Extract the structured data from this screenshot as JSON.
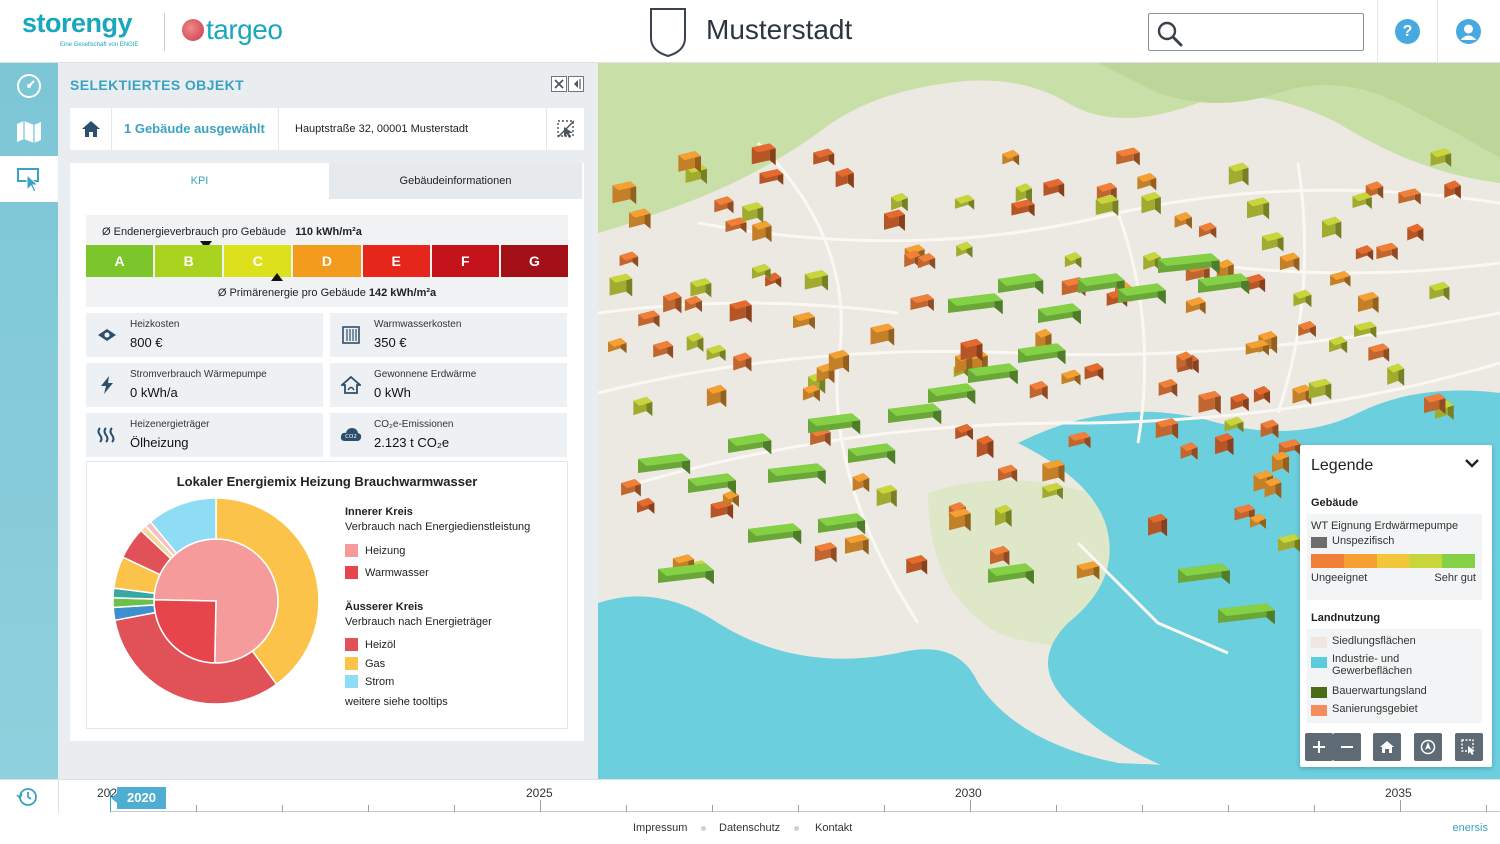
{
  "header": {
    "brand_primary": "storengy",
    "brand_primary_sub": "Eine Gesellschaft von ENGIE",
    "brand_secondary": "targeo",
    "city": "Musterstadt",
    "search": {
      "placeholder": "",
      "value": ""
    },
    "help_label": "?",
    "accent": "#1aa7bd"
  },
  "sidebar": {
    "items": [
      {
        "icon": "dashboard-gauge-icon",
        "active": false
      },
      {
        "icon": "map-icon",
        "active": false
      },
      {
        "icon": "select-object-icon",
        "active": true
      }
    ],
    "history_icon": "history-clock-icon"
  },
  "panel": {
    "title": "SELEKTIERTES OBJEKT",
    "selection": {
      "count_label": "1 Gebäude ausgewählt",
      "address": "Hauptstraße 32, 00001 Musterstadt"
    },
    "tabs": [
      {
        "label": "KPI",
        "active": true
      },
      {
        "label": "Gebäudeinformationen",
        "active": false
      }
    ],
    "efficiency": {
      "end_energy_label": "Ø Endenergieverbrauch pro Gebäude",
      "end_energy_value": "110 kWh/m²a",
      "primary_energy_label": "Ø Primärenergie pro Gebäude",
      "primary_energy_value": "142 kWh/m²a",
      "classes": [
        "A",
        "B",
        "C",
        "D",
        "E",
        "F",
        "G"
      ],
      "class_colors": [
        "#7cc62c",
        "#a9d31f",
        "#dde11c",
        "#f39b1c",
        "#e5271b",
        "#c5131b",
        "#a30f16"
      ],
      "end_energy_class": "B",
      "primary_energy_class": "C"
    },
    "kpis": [
      {
        "label": "Heizkosten",
        "value": "800 €",
        "icon": "heating-cost-icon"
      },
      {
        "label": "Warmwasserkosten",
        "value": "350 €",
        "icon": "radiator-icon"
      },
      {
        "label": "Stromverbrauch Wärmepumpe",
        "value": "0 kWh/a",
        "icon": "electricity-icon"
      },
      {
        "label": "Gewonnene Erdwärme",
        "value": "0 kWh",
        "icon": "geothermal-house-icon"
      },
      {
        "label": "Heizenergieträger",
        "value": "Ölheizung",
        "icon": "heat-waves-icon"
      },
      {
        "label": "CO₂e-Emissionen",
        "value": "2.123 t CO₂e",
        "icon": "co2-cloud-icon"
      }
    ],
    "energy_mix": {
      "title": "Lokaler Energiemix Heizung Brauchwarmwasser",
      "inner_title": "Innerer Kreis",
      "inner_subtitle": "Verbrauch nach Energiedienstleistung",
      "inner_items": [
        {
          "label": "Heizung",
          "color": "#f59b9b"
        },
        {
          "label": "Warmwasser",
          "color": "#e5454b"
        }
      ],
      "outer_title": "Äusserer Kreis",
      "outer_subtitle": "Verbrauch nach Energieträger",
      "outer_items": [
        {
          "label": "Heizöl",
          "color": "#e05258"
        },
        {
          "label": "Gas",
          "color": "#fbc34a"
        },
        {
          "label": "Strom",
          "color": "#8fdcf5"
        }
      ],
      "more_note": "weitere siehe tooltips"
    }
  },
  "chart_data": {
    "type": "pie",
    "title": "Lokaler Energiemix Heizung Brauchwarmwasser",
    "rings": [
      {
        "name": "Innerer Kreis",
        "slices": [
          {
            "label": "Heizung",
            "value": 75,
            "color": "#f59b9b"
          },
          {
            "label": "Warmwasser",
            "value": 25,
            "color": "#e5454b"
          }
        ]
      },
      {
        "name": "Äusserer Kreis",
        "slices": [
          {
            "label": "Gas",
            "value": 40,
            "color": "#fbc34a"
          },
          {
            "label": "Heizöl",
            "value": 32,
            "color": "#e05258"
          },
          {
            "label": "",
            "value": 2,
            "color": "#3f8fd0"
          },
          {
            "label": "",
            "value": 1.5,
            "color": "#6cc04a"
          },
          {
            "label": "",
            "value": 1.5,
            "color": "#3aa7a3"
          },
          {
            "label": "",
            "value": 5,
            "color": "#fbc34a"
          },
          {
            "label": "",
            "value": 5,
            "color": "#e05258"
          },
          {
            "label": "",
            "value": 1,
            "color": "#f3d9a0"
          },
          {
            "label": "",
            "value": 1,
            "color": "#f6c0c0"
          },
          {
            "label": "Strom",
            "value": 11,
            "color": "#8fdcf5"
          }
        ]
      }
    ]
  },
  "map": {
    "legend": {
      "title": "Legende",
      "buildings_title": "Gebäude",
      "suitability_label": "WT Eignung Erdwärmepumpe",
      "unspecific_label": "Unspezifisch",
      "gradient_colors": [
        "#f07f3a",
        "#f5a032",
        "#f2c73a",
        "#c8d63c",
        "#84d146"
      ],
      "low_label": "Ungeeignet",
      "high_label": "Sehr gut",
      "landuse_title": "Landnutzung",
      "landuse_items": [
        {
          "label": "Siedlungsflächen",
          "color": "#efe5e1"
        },
        {
          "label": "Industrie- und Gewerbeflächen",
          "color": "#5ccbdc"
        },
        {
          "label": "Bauerwartungsland",
          "color": "#4b6b16"
        },
        {
          "label": "Sanierungsgebiet",
          "color": "#f68d5c"
        }
      ]
    },
    "controls": [
      "zoom-in-icon",
      "zoom-out-icon",
      "home-icon",
      "compass-icon",
      "select-area-icon"
    ]
  },
  "timeline": {
    "years": [
      "2020",
      "2025",
      "2030",
      "2035"
    ],
    "current_year": "2020",
    "current_year_stub": "202"
  },
  "footer": {
    "links": [
      "Impressum",
      "Datenschutz",
      "Kontakt"
    ],
    "brand": "enersis"
  }
}
